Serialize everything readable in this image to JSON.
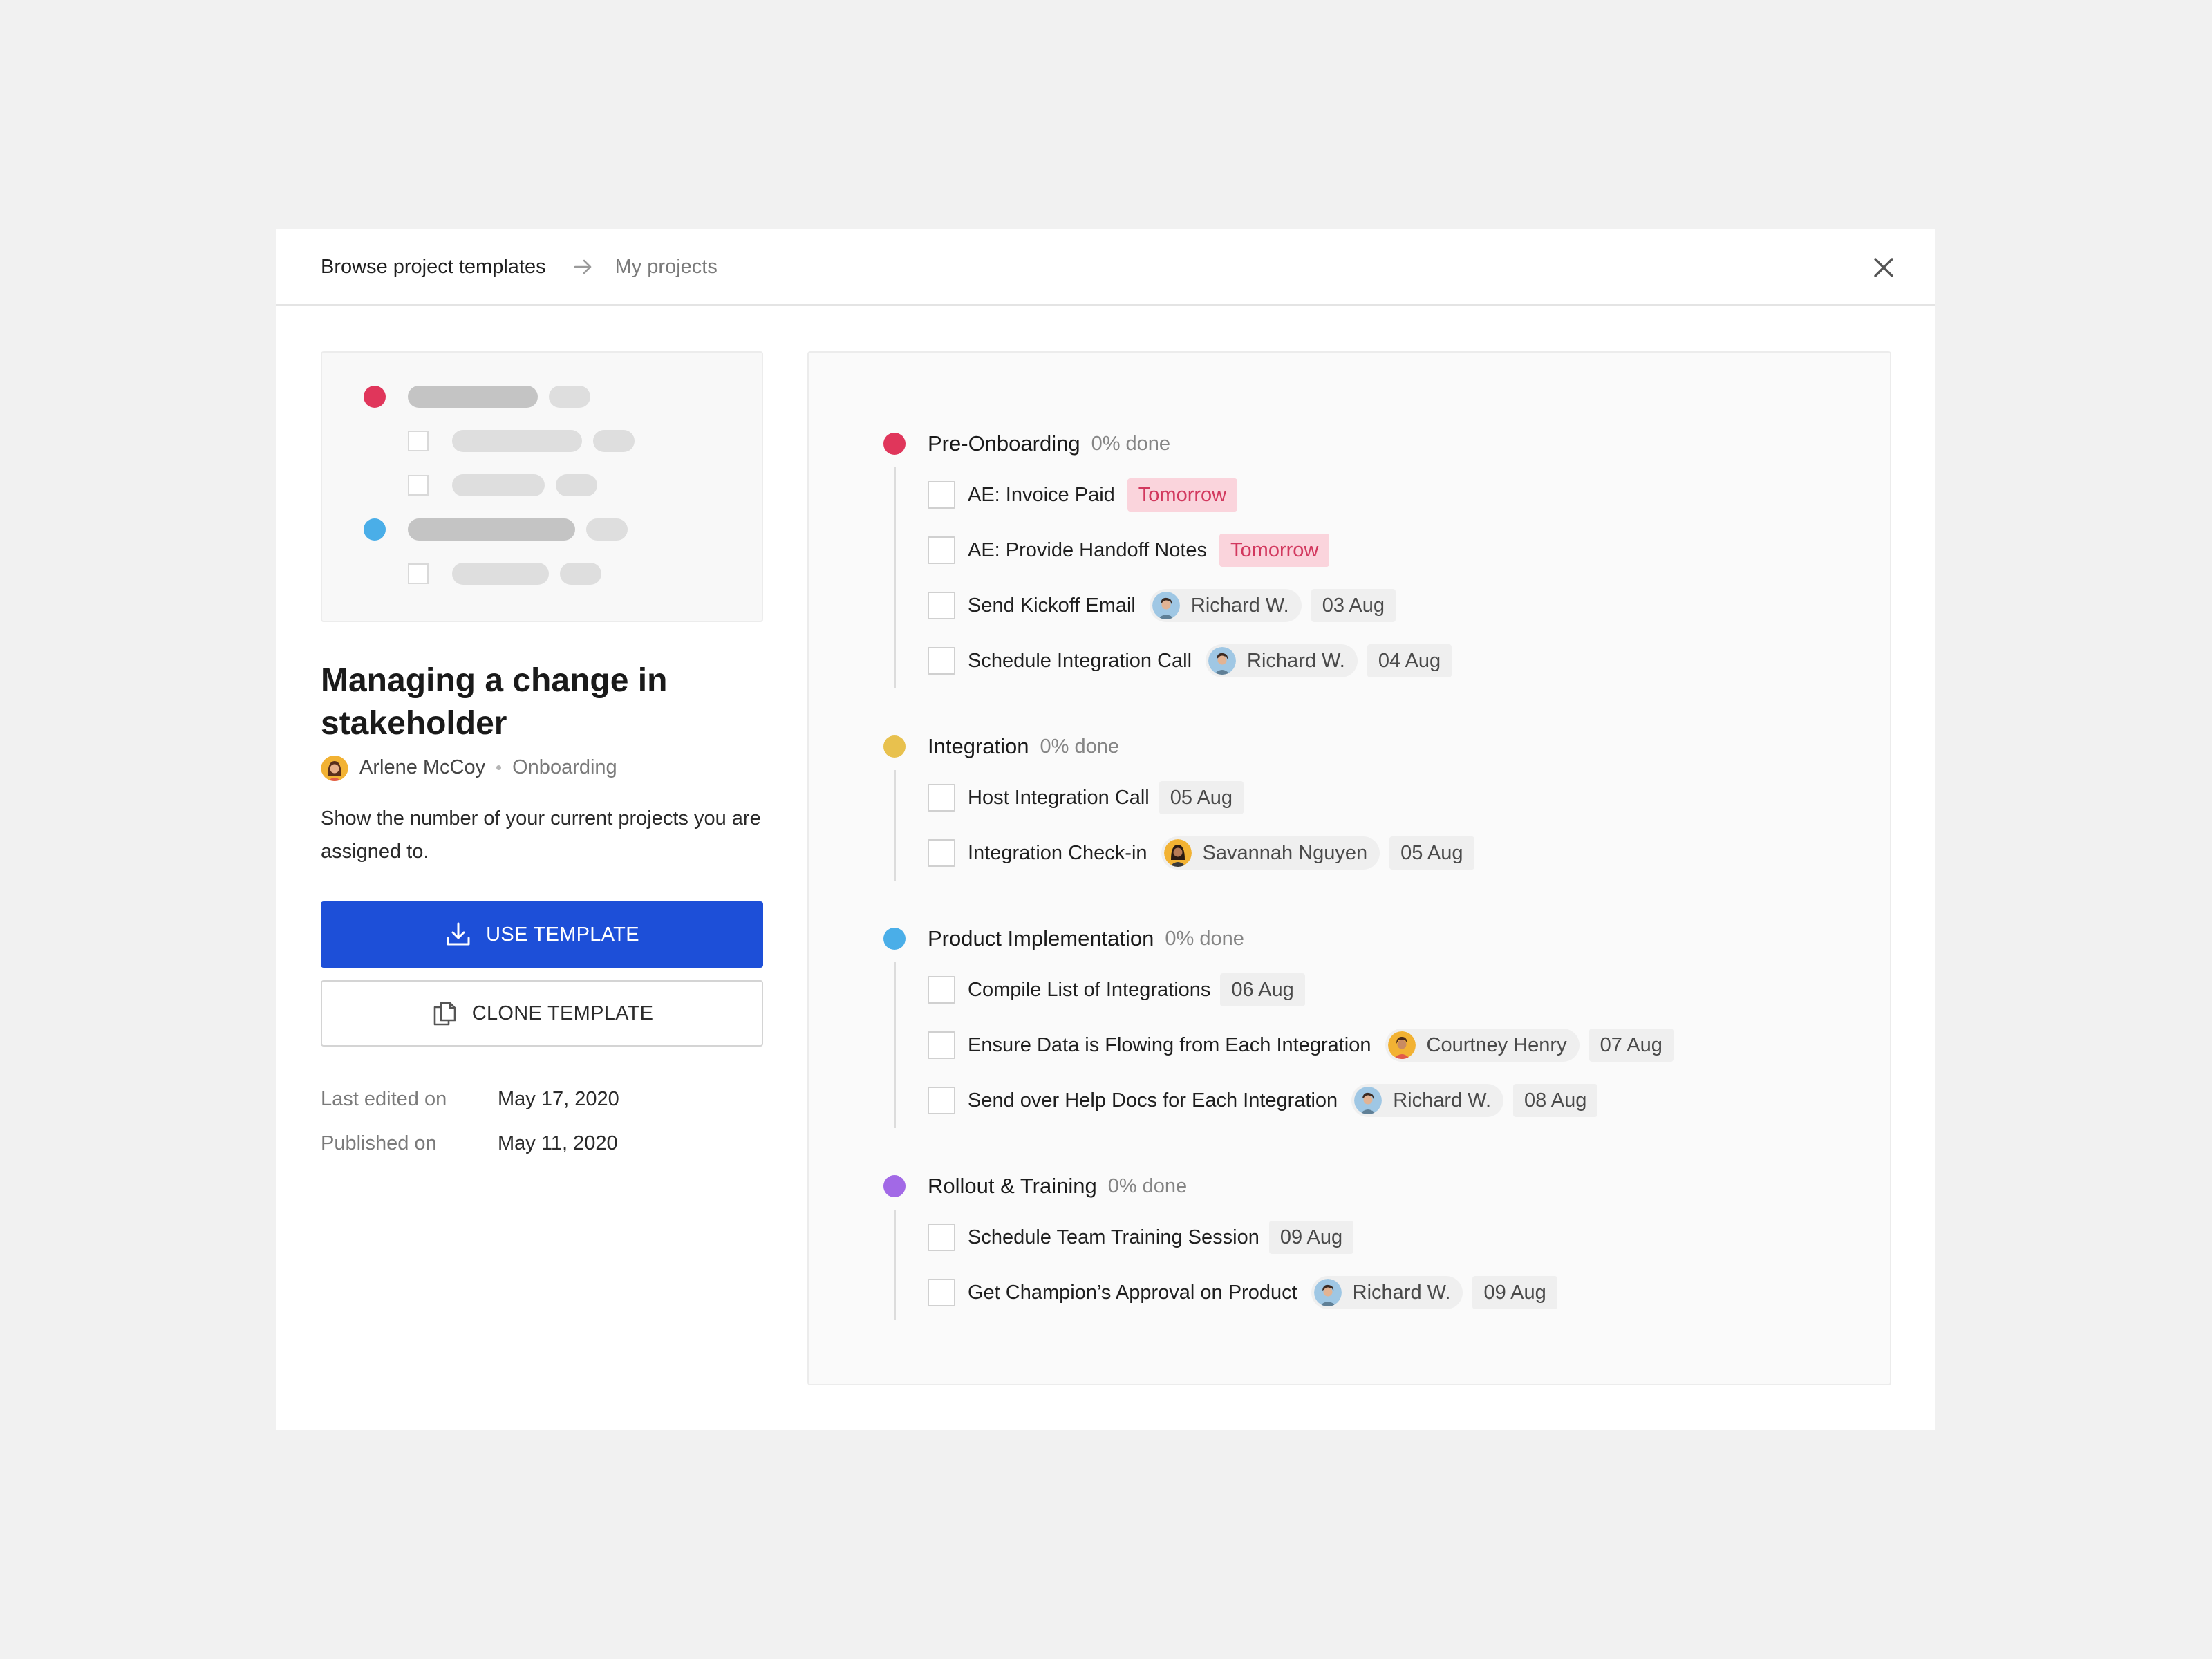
{
  "breadcrumb": {
    "current": "Browse project templates",
    "next": "My projects"
  },
  "template": {
    "title": "Managing a change in stakeholder",
    "author": "Arlene McCoy",
    "category": "Onboarding",
    "description": "Show the number of your current projects you are assigned to.",
    "use_label": "USE TEMPLATE",
    "clone_label": "CLONE TEMPLATE",
    "last_edited_label": "Last edited on",
    "last_edited": "May 17, 2020",
    "published_label": "Published on",
    "published": "May 11, 2020"
  },
  "colors": {
    "pre_onboarding": "#e0365b",
    "integration": "#e8c14e",
    "product_implementation": "#4aaee8",
    "rollout_training": "#a269e6",
    "primary_button": "#1d4fd8",
    "tomorrow_bg": "#fad4dc",
    "tomorrow_text": "#d2385e"
  },
  "icons": {
    "breadcrumb_separator": "arrow-right-icon",
    "close": "close-icon",
    "use_template": "download-icon",
    "clone_template": "copy-icon"
  },
  "sections": [
    {
      "name": "Pre-Onboarding",
      "progress": "0% done",
      "tasks": [
        {
          "name": "AE: Invoice Paid",
          "tag": "Tomorrow"
        },
        {
          "name": "AE: Provide Handoff Notes",
          "tag": "Tomorrow"
        },
        {
          "name": "Send Kickoff Email",
          "assignee": "Richard W.",
          "date": "03 Aug"
        },
        {
          "name": "Schedule Integration Call",
          "assignee": "Richard W.",
          "date": "04 Aug"
        }
      ]
    },
    {
      "name": "Integration",
      "progress": "0% done",
      "tasks": [
        {
          "name": "Host Integration Call",
          "date": "05 Aug"
        },
        {
          "name": "Integration Check-in",
          "assignee": "Savannah Nguyen",
          "date": "05 Aug"
        }
      ]
    },
    {
      "name": "Product Implementation",
      "progress": "0% done",
      "tasks": [
        {
          "name": "Compile List of Integrations",
          "date": "06 Aug"
        },
        {
          "name": "Ensure Data is Flowing from Each Integration",
          "assignee": "Courtney Henry",
          "date": "07 Aug"
        },
        {
          "name": "Send over Help Docs for Each Integration",
          "assignee": "Richard W.",
          "date": "08 Aug"
        }
      ]
    },
    {
      "name": "Rollout & Training",
      "progress": "0% done",
      "tasks": [
        {
          "name": "Schedule Team Training Session",
          "date": "09 Aug"
        },
        {
          "name": "Get Champion’s Approval on Product",
          "assignee": "Richard W.",
          "date": "09 Aug"
        }
      ]
    }
  ]
}
